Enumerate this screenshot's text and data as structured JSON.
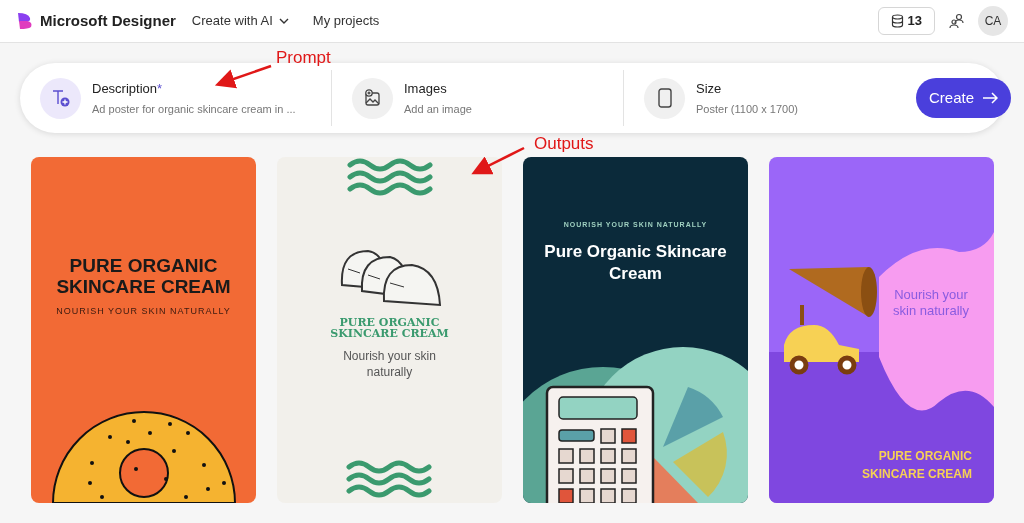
{
  "header": {
    "app_name": "Microsoft Designer",
    "nav": [
      {
        "label": "Create with AI",
        "dropdown": true
      },
      {
        "label": "My projects",
        "dropdown": false
      }
    ],
    "credits": "13",
    "avatar": "CA"
  },
  "prompt_bar": {
    "fields": [
      {
        "kind": "description",
        "label": "Description",
        "required_mark": "*",
        "value": "Ad poster for organic skincare cream in ..."
      },
      {
        "kind": "images",
        "label": "Images",
        "value": "Add an image"
      },
      {
        "kind": "size",
        "label": "Size",
        "value": "Poster (1100 x 1700)"
      }
    ],
    "create_button": "Create"
  },
  "outputs": [
    {
      "kind": "bagel",
      "title": "PURE ORGANIC SKINCARE CREAM",
      "subtitle": "NOURISH YOUR SKIN NATURALLY"
    },
    {
      "kind": "taco",
      "title": "PURE ORGANIC SKINCARE CREAM",
      "subtitle": "Nourish your skin naturally"
    },
    {
      "kind": "calculator",
      "title": "Pure Organic Skincare Cream",
      "subtitle": "NOURISH YOUR SKIN NATURALLY"
    },
    {
      "kind": "megaphone",
      "title": "PURE ORGANIC SKINCARE CREAM",
      "subtitle": "Nourish your skin naturally"
    }
  ],
  "annotations": [
    {
      "kind": "prompt",
      "text": "Prompt"
    },
    {
      "kind": "outputs",
      "text": "Outputs"
    }
  ]
}
